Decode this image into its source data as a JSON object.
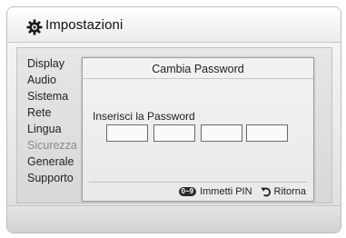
{
  "header": {
    "title": "Impostazioni",
    "icon": "gear-icon"
  },
  "sidebar": {
    "items": [
      {
        "label": "Display",
        "active": false
      },
      {
        "label": "Audio",
        "active": false
      },
      {
        "label": "Sistema",
        "active": false
      },
      {
        "label": "Rete",
        "active": false
      },
      {
        "label": "Lingua",
        "active": false
      },
      {
        "label": "Sicurezza",
        "active": true
      },
      {
        "label": "Generale",
        "active": false
      },
      {
        "label": "Supporto",
        "active": false
      }
    ]
  },
  "dialog": {
    "title": "Cambia Password",
    "field_label": "Inserisci la Password",
    "pin_boxes": [
      "",
      "",
      "",
      ""
    ],
    "footer": {
      "pin_key": "0~9",
      "pin_label": "Immetti PIN",
      "return_icon": "return-arrow-icon",
      "return_label": "Ritorna"
    }
  },
  "colors": {
    "active_menu_text": "#8a8a8a",
    "text": "#222222",
    "pin_box_border": "#6a6a6a"
  }
}
